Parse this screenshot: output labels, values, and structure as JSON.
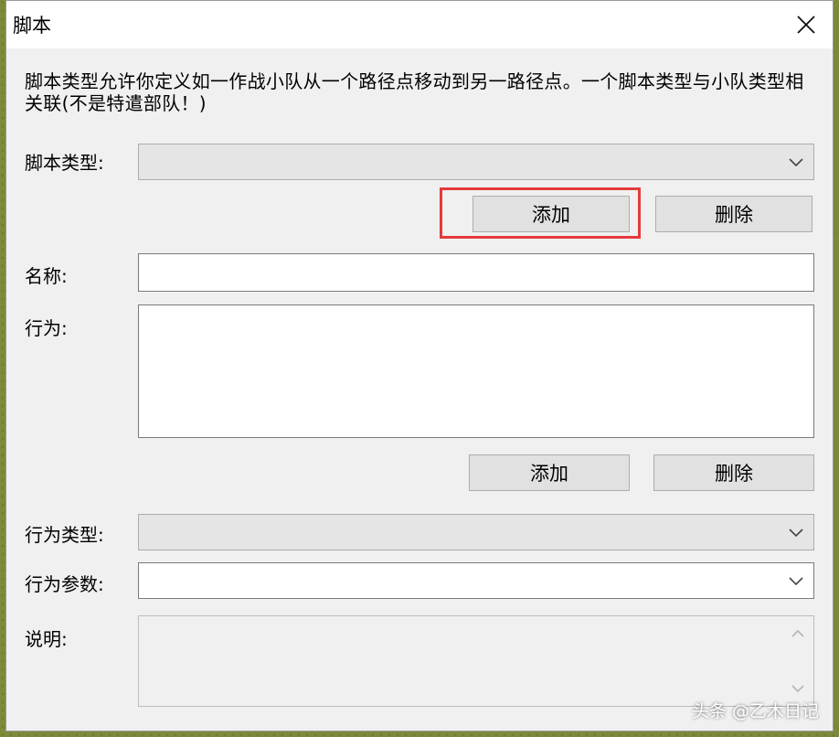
{
  "window": {
    "title": "脚本"
  },
  "description": "脚本类型允许你定义如一作战小队从一个路径点移动到另一路径点。一个脚本类型与小队类型相关联(不是特遣部队！)",
  "script_type": {
    "label": "脚本类型:",
    "value": ""
  },
  "script_buttons": {
    "add": "添加",
    "delete": "删除"
  },
  "name": {
    "label": "名称:",
    "value": ""
  },
  "actions": {
    "label": "行为:",
    "items": []
  },
  "action_buttons": {
    "add": "添加",
    "delete": "删除"
  },
  "action_type": {
    "label": "行为类型:",
    "value": ""
  },
  "action_param": {
    "label": "行为参数:",
    "value": ""
  },
  "explanation": {
    "label": "说明:",
    "value": ""
  },
  "watermark": "头条 @乙木日记",
  "colors": {
    "highlight": "#e53a3a",
    "dialog_bg": "#f0f0f0"
  },
  "icons": {
    "close": "close-icon",
    "dropdown": "chevron-down-icon",
    "scroll_up": "scroll-up-arrow-icon",
    "scroll_down": "scroll-down-arrow-icon"
  }
}
